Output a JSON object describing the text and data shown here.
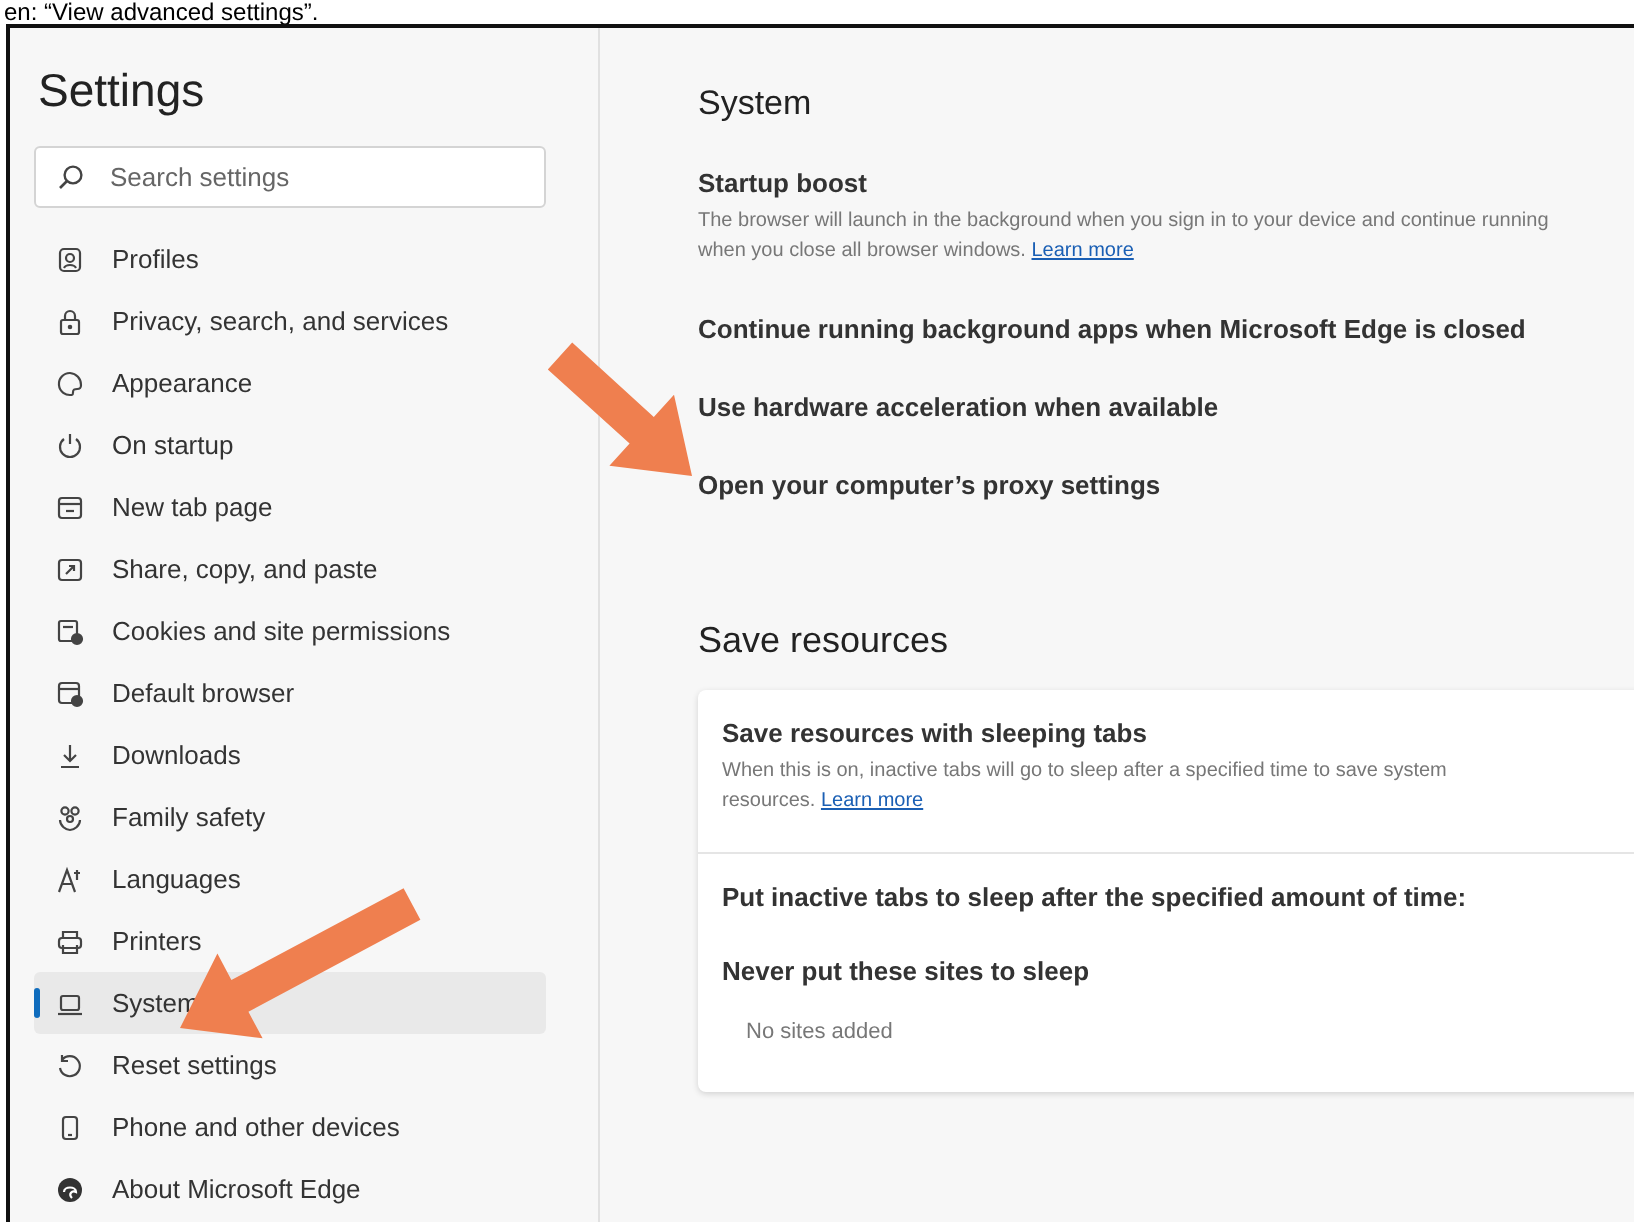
{
  "caption": "en: “View advanced settings”.",
  "sidebar": {
    "title": "Settings",
    "search": {
      "placeholder": "Search settings"
    },
    "items": [
      {
        "label": "Profiles",
        "selected": false
      },
      {
        "label": "Privacy, search, and services",
        "selected": false
      },
      {
        "label": "Appearance",
        "selected": false
      },
      {
        "label": "On startup",
        "selected": false
      },
      {
        "label": "New tab page",
        "selected": false
      },
      {
        "label": "Share, copy, and paste",
        "selected": false
      },
      {
        "label": "Cookies and site permissions",
        "selected": false
      },
      {
        "label": "Default browser",
        "selected": false
      },
      {
        "label": "Downloads",
        "selected": false
      },
      {
        "label": "Family safety",
        "selected": false
      },
      {
        "label": "Languages",
        "selected": false
      },
      {
        "label": "Printers",
        "selected": false
      },
      {
        "label": "System",
        "selected": true
      },
      {
        "label": "Reset settings",
        "selected": false
      },
      {
        "label": "Phone and other devices",
        "selected": false
      },
      {
        "label": "About Microsoft Edge",
        "selected": false
      }
    ]
  },
  "main": {
    "title": "System",
    "settings": [
      {
        "title": "Startup boost",
        "description": "The browser will launch in the background when you sign in to your device and continue running when you close all browser windows.",
        "link": "Learn more"
      },
      {
        "title": "Continue running background apps when Microsoft Edge is closed"
      },
      {
        "title": "Use hardware acceleration when available"
      },
      {
        "title": "Open your computer’s proxy settings"
      }
    ],
    "save_resources": {
      "title": "Save resources",
      "sleeping_tabs": {
        "title": "Save resources with sleeping tabs",
        "description": "When this is on, inactive tabs will go to sleep after a specified time to save system resources.",
        "link": "Learn more"
      },
      "sleep_after": {
        "title": "Put inactive tabs to sleep after the specified amount of time:"
      },
      "never_sleep": {
        "title": "Never put these sites to sleep",
        "empty": "No sites added"
      }
    }
  }
}
